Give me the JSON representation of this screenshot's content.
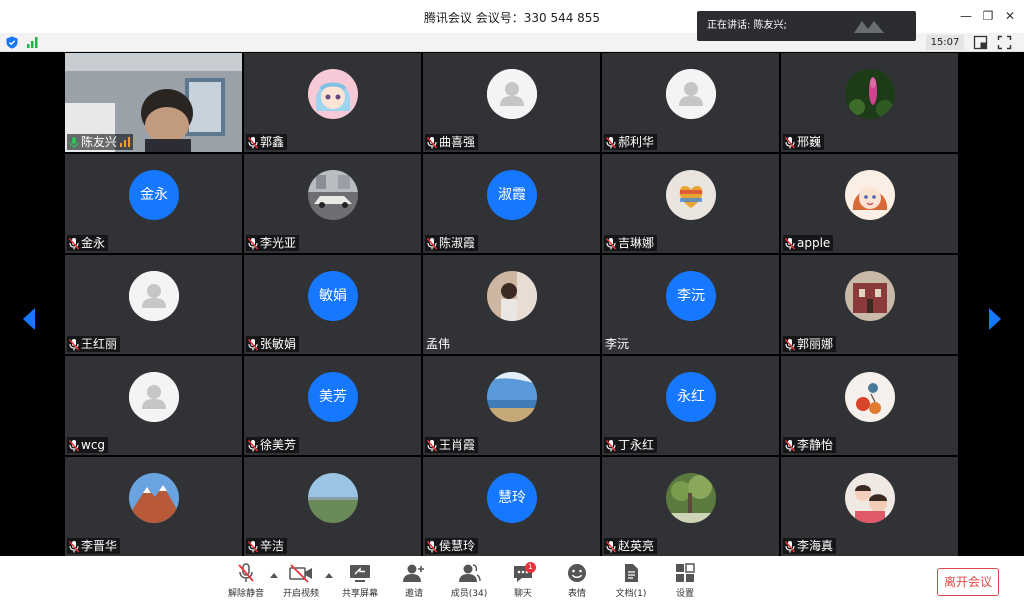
{
  "window": {
    "title": "腾讯会议 会议号：330 544 855",
    "speaking_prefix": "正在讲话: ",
    "speaking_name": "陈友兴;",
    "minimize": "—",
    "restore": "❐",
    "close": "✕"
  },
  "statusbar": {
    "time": "15:07"
  },
  "participants": [
    {
      "name": "陈友兴",
      "avatar": "video",
      "mic": "green"
    },
    {
      "name": "郭鑫",
      "avatar": "anime",
      "mic": "muted"
    },
    {
      "name": "曲喜强",
      "avatar": "default",
      "mic": "muted"
    },
    {
      "name": "郝利华",
      "avatar": "default",
      "mic": "muted"
    },
    {
      "name": "邢巍",
      "avatar": "flower",
      "mic": "muted"
    },
    {
      "name": "金永",
      "avatar": "text",
      "avatar_text": "金永",
      "mic": "muted"
    },
    {
      "name": "李光亚",
      "avatar": "car",
      "mic": "muted"
    },
    {
      "name": "陈淑霞",
      "avatar": "text",
      "avatar_text": "淑霞",
      "mic": "muted"
    },
    {
      "name": "吉琳娜",
      "avatar": "heart",
      "mic": "muted"
    },
    {
      "name": "apple",
      "avatar": "girl",
      "mic": "muted"
    },
    {
      "name": "王红丽",
      "avatar": "default",
      "mic": "muted"
    },
    {
      "name": "张敏娟",
      "avatar": "text",
      "avatar_text": "敏娟",
      "mic": "muted"
    },
    {
      "name": "孟伟",
      "avatar": "photo",
      "mic": "none"
    },
    {
      "name": "李沅",
      "avatar": "text",
      "avatar_text": "李沅",
      "mic": "none"
    },
    {
      "name": "郭丽娜",
      "avatar": "building",
      "mic": "muted"
    },
    {
      "name": "wcg",
      "avatar": "default",
      "mic": "muted"
    },
    {
      "name": "徐美芳",
      "avatar": "text",
      "avatar_text": "美芳",
      "mic": "muted"
    },
    {
      "name": "王肖霞",
      "avatar": "sea",
      "mic": "muted"
    },
    {
      "name": "丁永红",
      "avatar": "text",
      "avatar_text": "永红",
      "mic": "muted"
    },
    {
      "name": "李静怡",
      "avatar": "bird",
      "mic": "muted"
    },
    {
      "name": "李晋华",
      "avatar": "mountain",
      "mic": "muted"
    },
    {
      "name": "辛洁",
      "avatar": "field",
      "mic": "muted"
    },
    {
      "name": "侯慧玲",
      "avatar": "text",
      "avatar_text": "慧玲",
      "mic": "muted"
    },
    {
      "name": "赵英亮",
      "avatar": "tree",
      "mic": "muted"
    },
    {
      "name": "李海真",
      "avatar": "kids",
      "mic": "muted"
    }
  ],
  "toolbar": {
    "unmute": "解除静音",
    "start_video": "开启视频",
    "share_screen": "共享屏幕",
    "invite": "邀请",
    "members": "成员(34)",
    "chat": "聊天",
    "chat_badge": "1",
    "reactions": "表情",
    "docs": "文档(1)",
    "settings": "设置",
    "leave": "离开会议"
  },
  "colors": {
    "accent": "#1677ff",
    "tile_bg": "#303236",
    "leave_red": "#e04a4a",
    "badge_red": "#e8343a"
  }
}
